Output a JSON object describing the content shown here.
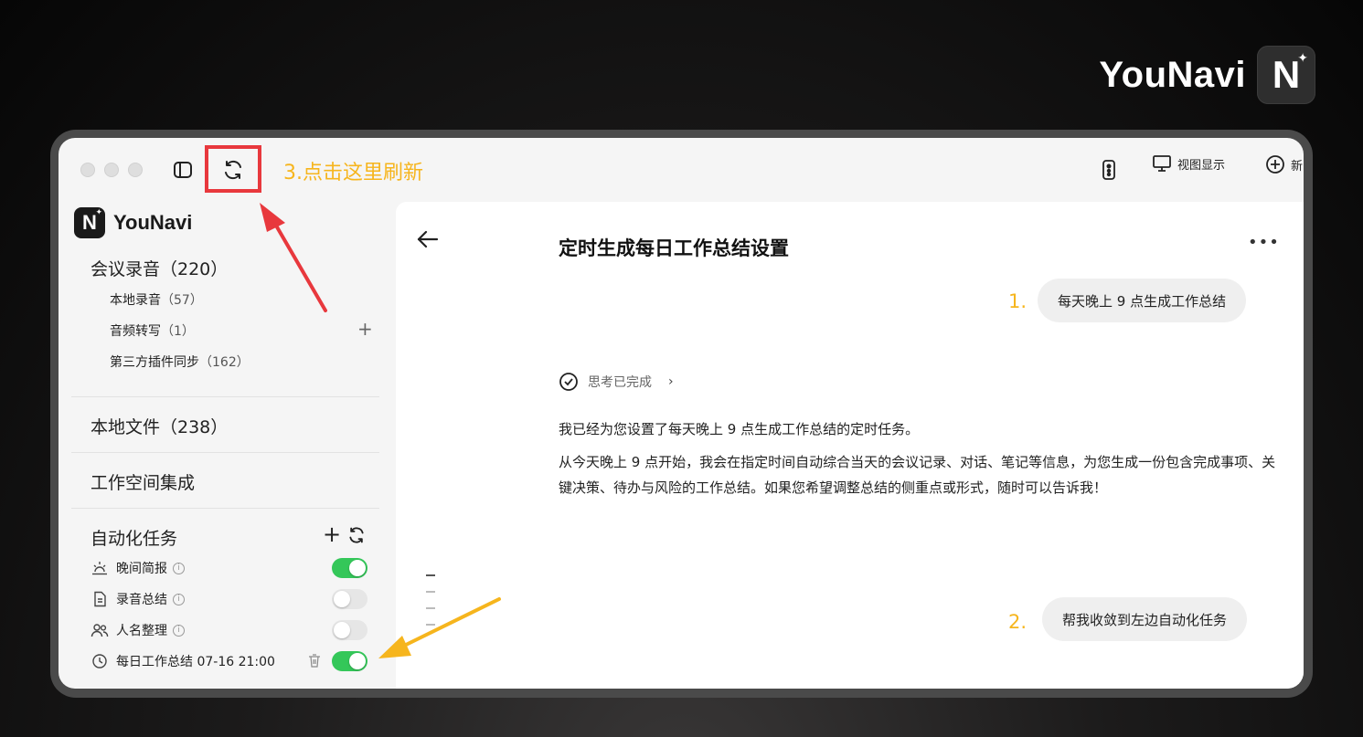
{
  "brand": {
    "name": "YouNavi",
    "logo_letter": "N"
  },
  "toolbar": {
    "annotation": "3.点击这里刷新",
    "view_label": "视图显示",
    "new_label": "新"
  },
  "sidebar": {
    "logo_letter": "N",
    "app_name": "YouNavi",
    "meetings": {
      "title": "会议录音（220）",
      "items": [
        {
          "label": "本地录音",
          "count": "（57）"
        },
        {
          "label": "音频转写",
          "count": "（1）"
        },
        {
          "label": "第三方插件同步",
          "count": "（162）"
        }
      ],
      "add_icon": "+"
    },
    "local_files": "本地文件（238）",
    "workspace": "工作空间集成",
    "automation": {
      "title": "自动化任务",
      "add_icon": "+",
      "tasks": [
        {
          "label": "晚间简报",
          "icon": "sunset-icon",
          "enabled": true
        },
        {
          "label": "录音总结",
          "icon": "document-icon",
          "enabled": false
        },
        {
          "label": "人名整理",
          "icon": "users-icon",
          "enabled": false
        },
        {
          "label": "每日工作总结 07-16 21:00",
          "icon": "clock-icon",
          "enabled": true
        }
      ]
    }
  },
  "main": {
    "title": "定时生成每日工作总结设置",
    "user_message_1": "每天晚上 9 点生成工作总结",
    "annotation_1": "1.",
    "thinking_status": "思考已完成",
    "reply_line_1": "我已经为您设置了每天晚上 9 点生成工作总结的定时任务。",
    "reply_line_2": "从今天晚上 9 点开始，我会在指定时间自动综合当天的会议记录、对话、笔记等信息，为您生成一份包含完成事项、关键决策、待办与风险的工作总结。如果您希望调整总结的侧重点或形式，随时可以告诉我！",
    "user_message_2": "帮我收敛到左边自动化任务",
    "annotation_2": "2."
  },
  "colors": {
    "accent_annotation": "#f6b51d",
    "highlight_red": "#e8383d",
    "toggle_on": "#34c759"
  }
}
